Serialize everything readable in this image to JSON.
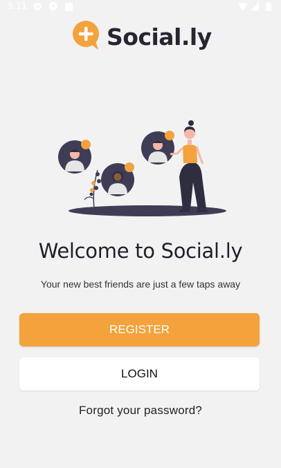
{
  "status_bar": {
    "time": "3:11",
    "icons": [
      "gear-icon",
      "shield-icon",
      "clipboard-icon",
      "wifi-icon",
      "signal-icon",
      "battery-icon"
    ]
  },
  "brand": {
    "name": "Social.ly",
    "accent_color": "#f3a23c",
    "text_color": "#262633"
  },
  "welcome": {
    "title": "Welcome to Social.ly",
    "subtitle": "Your new best friends are just a few taps away"
  },
  "actions": {
    "register_label": "REGISTER",
    "login_label": "LOGIN",
    "forgot_password_label": "Forgot your password?"
  }
}
